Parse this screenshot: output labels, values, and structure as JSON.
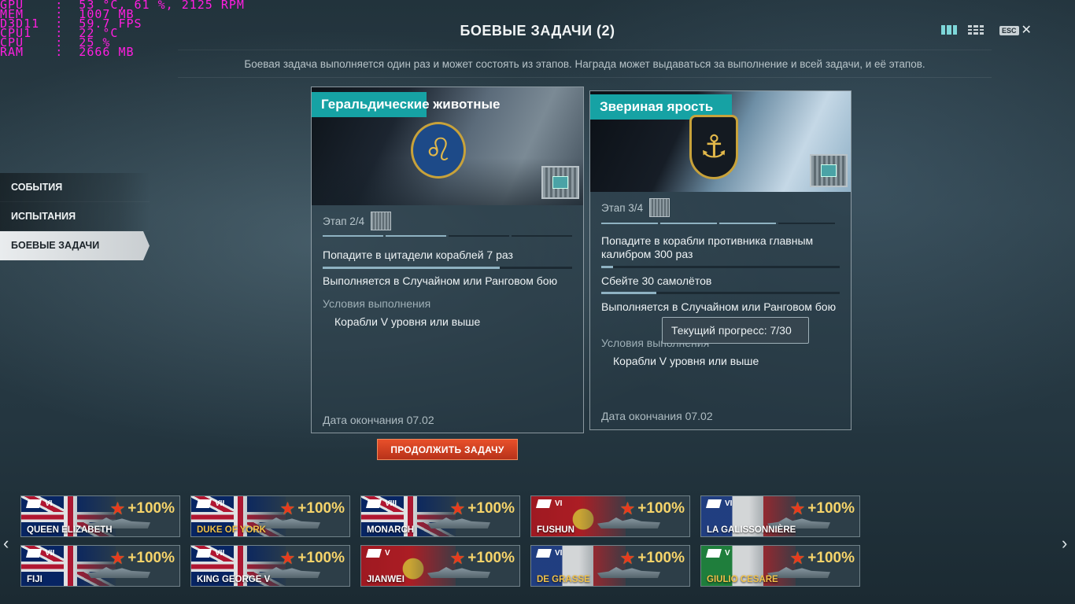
{
  "overlay": {
    "lines": [
      "GPU    :  53 °C, 61 %, 2125 RPM",
      "MEM    :  1007 MB",
      "D3D11  :  59.7 FPS",
      "CPU1   :  22 °C",
      "CPU    :  25 %",
      "RAM    :  2666 MB"
    ]
  },
  "header": {
    "title": "БОЕВЫЕ ЗАДАЧИ (2)",
    "esc_label": "ESC",
    "close_glyph": "✕"
  },
  "subtitle": "Боевая задача выполняется один раз и может состоять из этапов. Награда может выдаваться за выполнение и всей задачи, и её этапов.",
  "sidebar": {
    "items": [
      {
        "label": "СОБЫТИЯ"
      },
      {
        "label": "ИСПЫТАНИЯ"
      },
      {
        "label": "БОЕВЫЕ ЗАДАЧИ"
      }
    ]
  },
  "tasks": [
    {
      "title": "Геральдические животные",
      "stage": "Этап 2/4",
      "objective": "Попадите в цитадели кораблей 7 раз",
      "objective_progress": 0.71,
      "mode": "Выполняется в Случайном или Ранговом бою",
      "conditions_label": "Условия выполнения",
      "condition": "Корабли V уровня или выше",
      "end_date": "Дата окончания 07.02",
      "emblem_icon": "lion-icon"
    },
    {
      "title": "Звериная ярость",
      "stage": "Этап 3/4",
      "objective1": "Попадите в корабли противника главным калибром 300 раз",
      "objective1_progress": 0.05,
      "objective2": "Сбейте 30 самолётов",
      "objective2_progress": 0.23,
      "mode": "Выполняется в Случайном или Ранговом бою",
      "conditions_label": "Условия выполнения",
      "condition": "Корабли V уровня или выше",
      "end_date": "Дата окончания 07.02",
      "emblem_icon": "anchor-icon"
    }
  ],
  "continue_button": "ПРОДОЛЖИТЬ ЗАДАЧУ",
  "tooltip": "Текущий прогресс: 7/30",
  "ships": [
    {
      "name": "QUEEN ELIZABETH",
      "tier": "VI",
      "flag": "uk",
      "bonus": "+100%",
      "gold": false
    },
    {
      "name": "DUKE OF YORK",
      "tier": "VII",
      "flag": "uk",
      "bonus": "+100%",
      "gold": true
    },
    {
      "name": "MONARCH",
      "tier": "VIII",
      "flag": "uk",
      "bonus": "+100%",
      "gold": false
    },
    {
      "name": "FUSHUN",
      "tier": "VI",
      "flag": "cn",
      "bonus": "+100%",
      "gold": false
    },
    {
      "name": "LA GALISSONNIÈRE",
      "tier": "VI",
      "flag": "fr",
      "bonus": "+100%",
      "gold": false
    },
    {
      "name": "FIJI",
      "tier": "VII",
      "flag": "uk",
      "bonus": "+100%",
      "gold": false
    },
    {
      "name": "KING GEORGE V",
      "tier": "VII",
      "flag": "uk",
      "bonus": "+100%",
      "gold": false
    },
    {
      "name": "JIANWEI",
      "tier": "V",
      "flag": "cn",
      "bonus": "+100%",
      "gold": false
    },
    {
      "name": "DE GRASSE",
      "tier": "VI",
      "flag": "fr",
      "bonus": "+100%",
      "gold": true
    },
    {
      "name": "GIULIO CESARE",
      "tier": "V",
      "flag": "it",
      "bonus": "+100%",
      "gold": true
    }
  ],
  "carousel": {
    "prev_glyph": "‹",
    "next_glyph": "›"
  },
  "colors": {
    "accent": "#16a2a4",
    "button": "#d8421f",
    "bonus": "#f6d46a"
  }
}
